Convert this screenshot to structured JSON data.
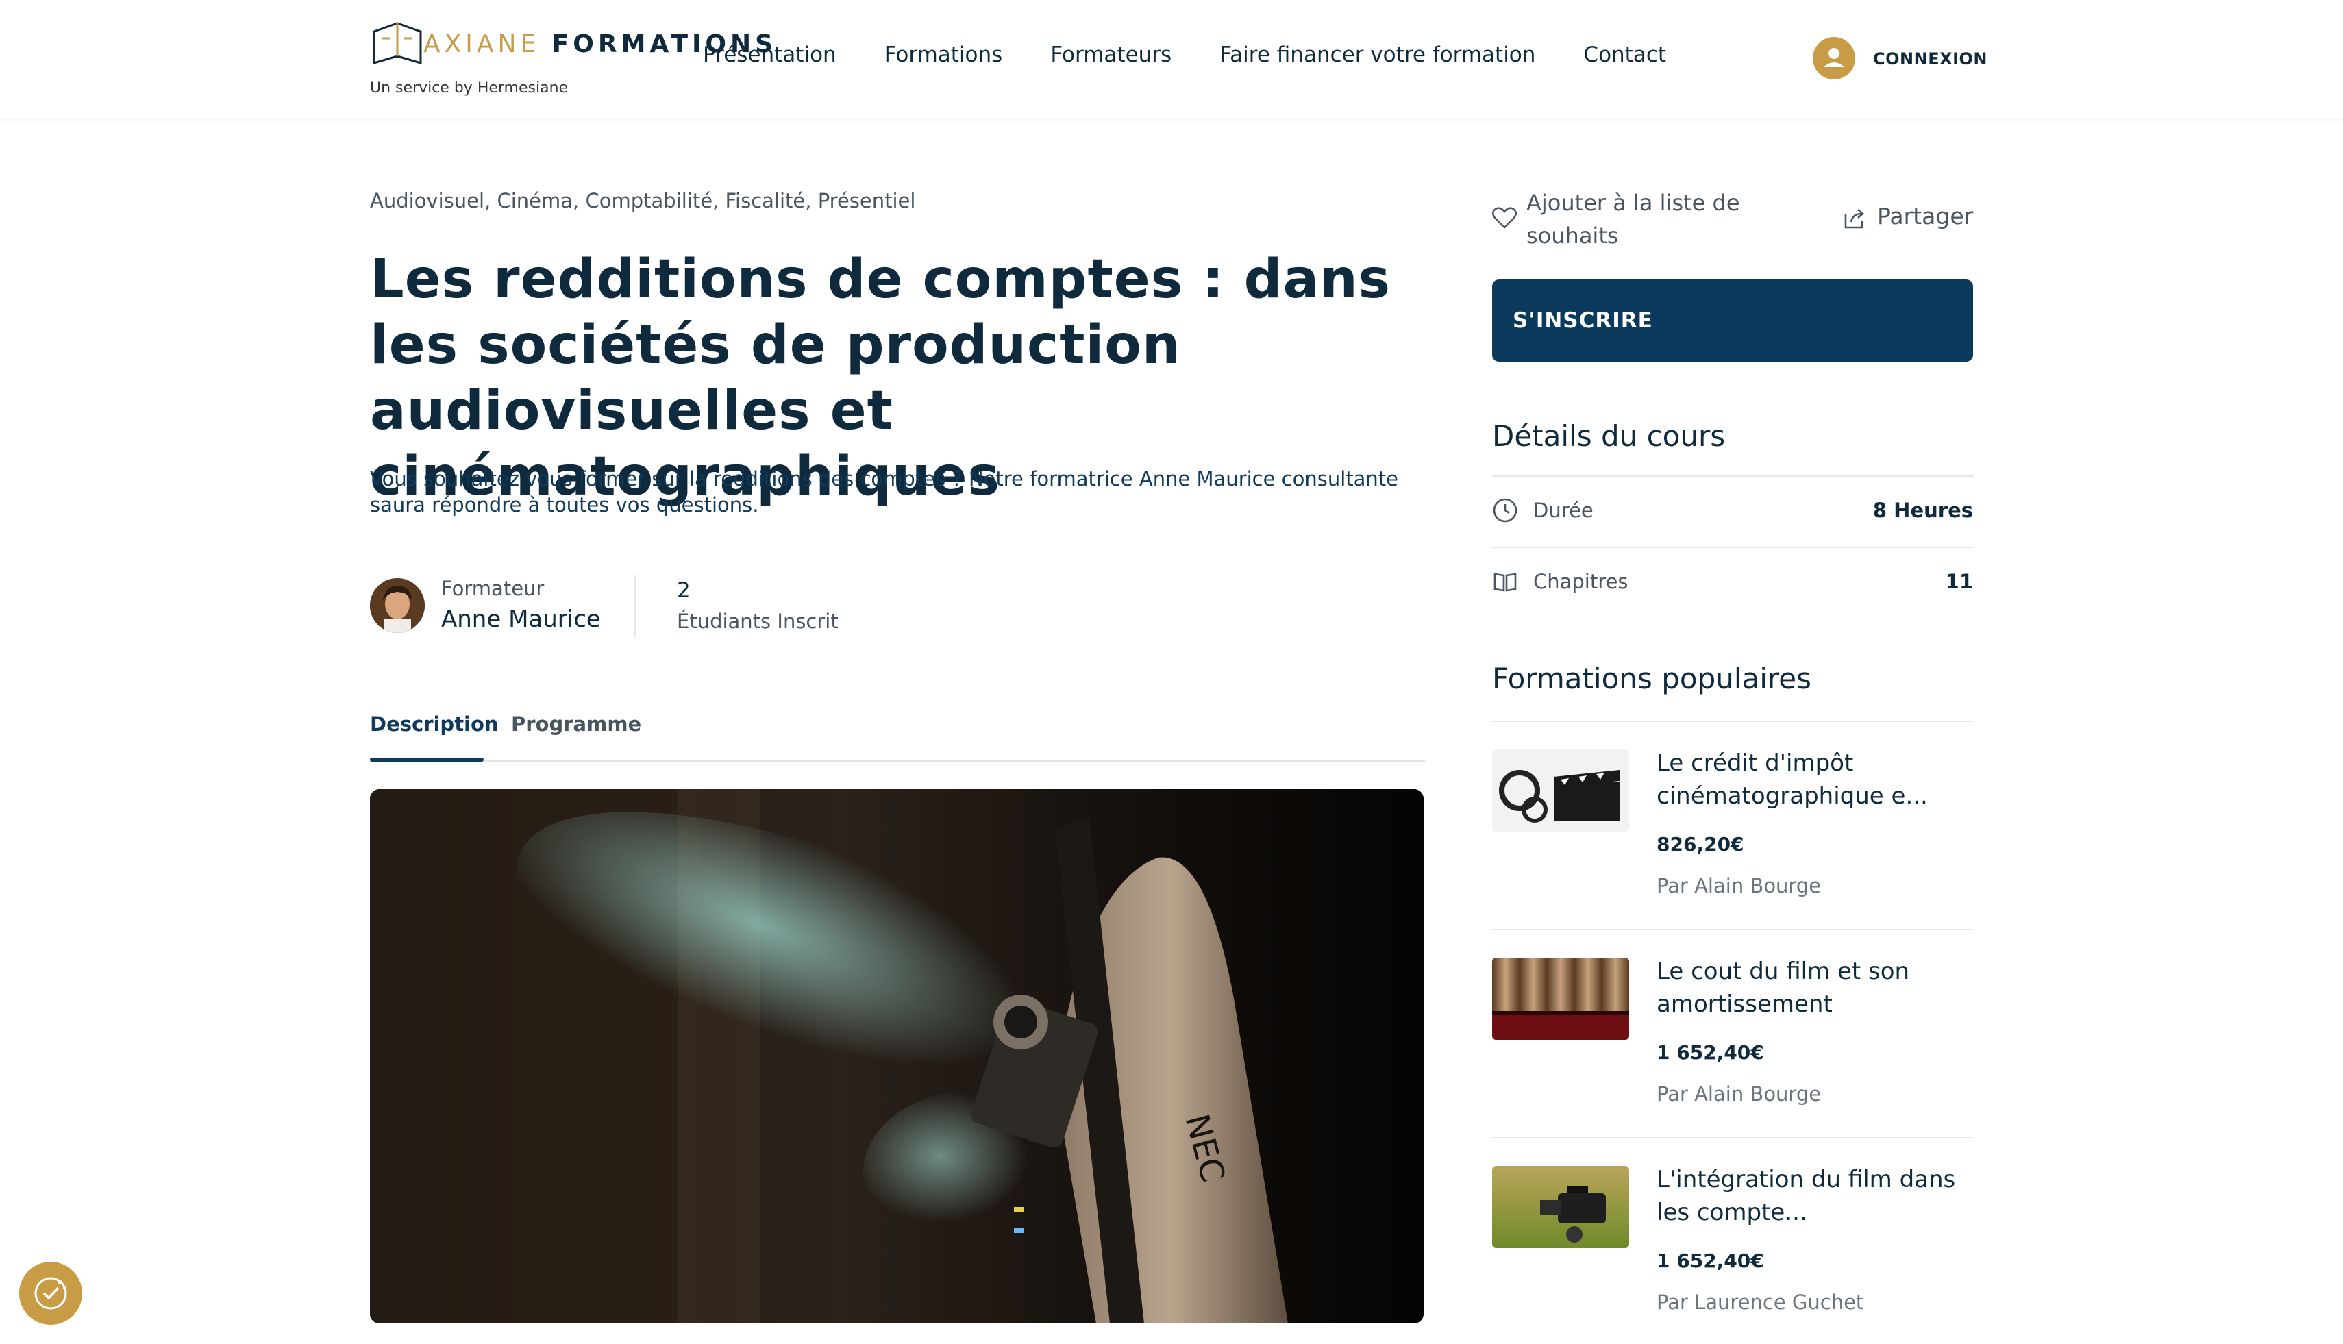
{
  "header": {
    "logo_part1": "AXIANE",
    "logo_part2": "FORMATIONS",
    "logo_sub": "Un service by Hermesiane",
    "nav": [
      "Présentation",
      "Formations",
      "Formateurs",
      "Faire financer votre formation",
      "Contact"
    ],
    "login": "CONNEXION",
    "accent": "#c89b45"
  },
  "course": {
    "categories": "Audiovisuel, Cinéma, Comptabilité, Fiscalité, Présentiel",
    "title": "Les redditions de comptes : dans les sociétés de production audiovisuelles et cinématographiques",
    "subtitle": "Vous souhaitez vous former sur la redditions des comptes ? Notre formatrice Anne Maurice consultante saura répondre à toutes vos questions.",
    "trainer_label": "Formateur",
    "trainer_name": "Anne Maurice",
    "students_count": "2",
    "students_label": "Étudiants Inscrit",
    "tabs": [
      "Description",
      "Programme"
    ],
    "active_tab": "Description"
  },
  "sidebar": {
    "wishlist": "Ajouter à la liste de souhaits",
    "share": "Partager",
    "enroll": "S'INSCRIRE",
    "details_title": "Détails du cours",
    "details": [
      {
        "label": "Durée",
        "value": "8 Heures",
        "icon": "clock-icon"
      },
      {
        "label": "Chapitres",
        "value": "11",
        "icon": "book-icon"
      }
    ],
    "popular_title": "Formations populaires",
    "popular": [
      {
        "title": "Le crédit d'impôt cinématographique e...",
        "price": "826,20€",
        "author": "Par Alain Bourge"
      },
      {
        "title": "Le cout du film et son amortissement",
        "price": "1 652,40€",
        "author": "Par Alain Bourge"
      },
      {
        "title": "L'intégration du film dans les compte...",
        "price": "1 652,40€",
        "author": "Par Laurence Guchet"
      }
    ]
  },
  "colors": {
    "primary": "#0b3a5c",
    "gold": "#c89b45"
  }
}
